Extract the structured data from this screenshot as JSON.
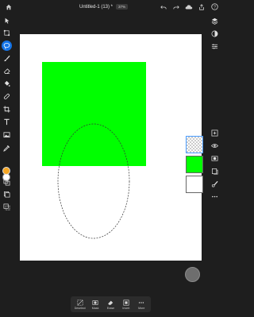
{
  "header": {
    "document_title": "Untitled-1 (13) *",
    "zoom_level": "37%"
  },
  "colors": {
    "app_bg": "#1e1e1e",
    "accent": "#1473e6",
    "layer_green": "#00ff00",
    "foreground_color": "#f5a623",
    "background_color": "#ffffff"
  },
  "left_tools": [
    {
      "name": "move-tool",
      "icon": "arrow-icon"
    },
    {
      "name": "transform-tool",
      "icon": "transform-icon"
    },
    {
      "name": "selection-tool",
      "icon": "lasso-icon",
      "active": true
    },
    {
      "name": "brush-tool",
      "icon": "brush-icon"
    },
    {
      "name": "eraser-tool",
      "icon": "eraser-icon"
    },
    {
      "name": "fill-tool",
      "icon": "bucket-icon"
    },
    {
      "name": "heal-tool",
      "icon": "bandage-icon"
    },
    {
      "name": "crop-tool",
      "icon": "crop-icon"
    },
    {
      "name": "type-tool",
      "icon": "type-icon"
    },
    {
      "name": "place-image-tool",
      "icon": "image-icon"
    },
    {
      "name": "eyedropper-tool",
      "icon": "eyedropper-icon"
    }
  ],
  "layers": [
    {
      "name": "empty-layer",
      "selected": true
    },
    {
      "name": "green-layer",
      "selected": false
    },
    {
      "name": "background-layer",
      "selected": false
    }
  ],
  "taskbar": {
    "items": [
      {
        "label": "Deselect",
        "icon": "deselect-icon"
      },
      {
        "label": "Mask",
        "icon": "mask-icon"
      },
      {
        "label": "Erase",
        "icon": "erase-icon"
      },
      {
        "label": "Invert",
        "icon": "invert-icon"
      },
      {
        "label": "More",
        "icon": "more-icon"
      }
    ]
  }
}
